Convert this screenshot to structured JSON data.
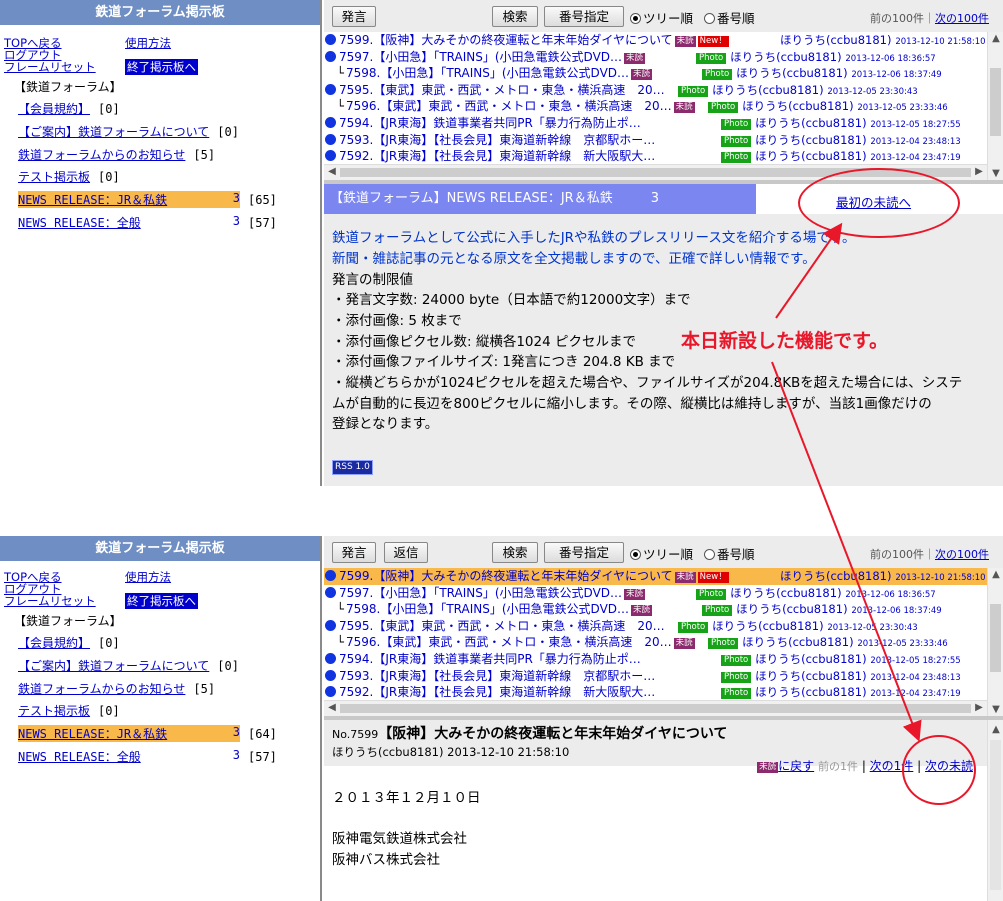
{
  "left": {
    "title": "鉄道フォーラム掲示板",
    "links": {
      "top_back": "TOPへ戻る",
      "usage": "使用方法",
      "logout": "ログアウト",
      "frame_reset": "フレームリセット",
      "exit_board": "終了掲示板へ"
    },
    "section": "【鉄道フォーラム】",
    "forums": [
      {
        "title": "【会員規約】",
        "count": "[0]"
      },
      {
        "title": "【ご案内】鉄道フォーラムについて",
        "count": "[0]"
      },
      {
        "title": "鉄道フォーラムからのお知らせ",
        "count": "[5]"
      },
      {
        "title": "テスト掲示板",
        "count": "[0]"
      },
      {
        "title": "NEWS RELEASE：JR＆私鉄",
        "num": "3",
        "count_top": "[65]",
        "count_bottom": "[64]"
      },
      {
        "title": "NEWS RELEASE：全般",
        "num": "3",
        "count": "[57]"
      }
    ]
  },
  "toolbar": {
    "post": "発言",
    "reply": "返信",
    "search": "検索",
    "num_spec": "番号指定",
    "tree_order": "ツリー順",
    "num_order": "番号順",
    "prev_page": "前の100件",
    "next_page": "次の100件"
  },
  "tags": {
    "unread": "未読",
    "new": "New！",
    "photo": "Photo"
  },
  "messages": [
    {
      "subject": "7599.【阪神】大みそかの終夜運転と年末年始ダイヤについて",
      "author": "ほりうち(ccbu8181)",
      "date": "2013-12-10 21:58:10"
    },
    {
      "subject": "7597.【小田急】「TRAINS」(小田急電鉄公式DVD…",
      "author": "ほりうち(ccbu8181)",
      "date": "2013-12-06 18:36:57"
    },
    {
      "subject": "7598.【小田急】「TRAINS」(小田急電鉄公式DVD…",
      "author": "ほりうち(ccbu8181)",
      "date": "2013-12-06 18:37:49"
    },
    {
      "subject": "7595.【東武】東武・西武・メトロ・東急・横浜高速　20…",
      "author": "ほりうち(ccbu8181)",
      "date": "2013-12-05 23:30:43"
    },
    {
      "subject": "7596.【東武】東武・西武・メトロ・東急・横浜高速　20…",
      "author": "ほりうち(ccbu8181)",
      "date": "2013-12-05 23:33:46"
    },
    {
      "subject": "7594.【JR東海】鉄道事業者共同PR「暴力行為防止ポ…",
      "author": "ほりうち(ccbu8181)",
      "date": "2013-12-05 18:27:55"
    },
    {
      "subject": "7593.【JR東海】【社長会見】東海道新幹線　京都駅ホー…",
      "author": "ほりうち(ccbu8181)",
      "date": "2013-12-04 23:48:13"
    },
    {
      "subject": "7592.【JR東海】【社長会見】東海道新幹線　新大阪駅大…",
      "author": "ほりうち(ccbu8181)",
      "date": "2013-12-04 23:47:19"
    }
  ],
  "detail": {
    "header": "【鉄道フォーラム】NEWS RELEASE：JR＆私鉄",
    "header_num": "3",
    "first_unread": "最初の未読へ",
    "lines": [
      "鉄道フォーラムとして公式に入手したJRや私鉄のプレスリリース文を紹介する場です。",
      "新聞・雑誌記事の元となる原文を全文掲載しますので、正確で詳しい情報です。",
      "発言の制限値",
      "・発言文字数: 24000 byte（日本語で約12000文字）まで",
      "・添付画像: 5 枚まで",
      "・添付画像ピクセル数: 縦横各1024 ピクセルまで",
      "・添付画像ファイルサイズ: 1発言につき 204.8 KB まで",
      "・縦横どちらかが1024ピクセルを超えた場合や、ファイルサイズが204.8KBを超えた場合には、システ",
      "ムが自動的に長辺を800ピクセルに縮小します。その際、縦横比は維持しますが、当該1画像だけの",
      "登録となります。"
    ],
    "rss": "RSS 1.0"
  },
  "annotation": "本日新設した機能です。",
  "post": {
    "no": "No.7599",
    "title": "【阪神】大みそかの終夜運転と年末年始ダイヤについて",
    "meta": "ほりうち(ccbu8181) 2013-12-10 21:58:10",
    "back_unread": "に戻す",
    "prev_one": "前の1件",
    "next_one": "次の1件",
    "next_unread": "次の未読",
    "body": [
      "２０１３年１２月１０日",
      "",
      "阪神電気鉄道株式会社",
      "阪神バス株式会社"
    ]
  }
}
